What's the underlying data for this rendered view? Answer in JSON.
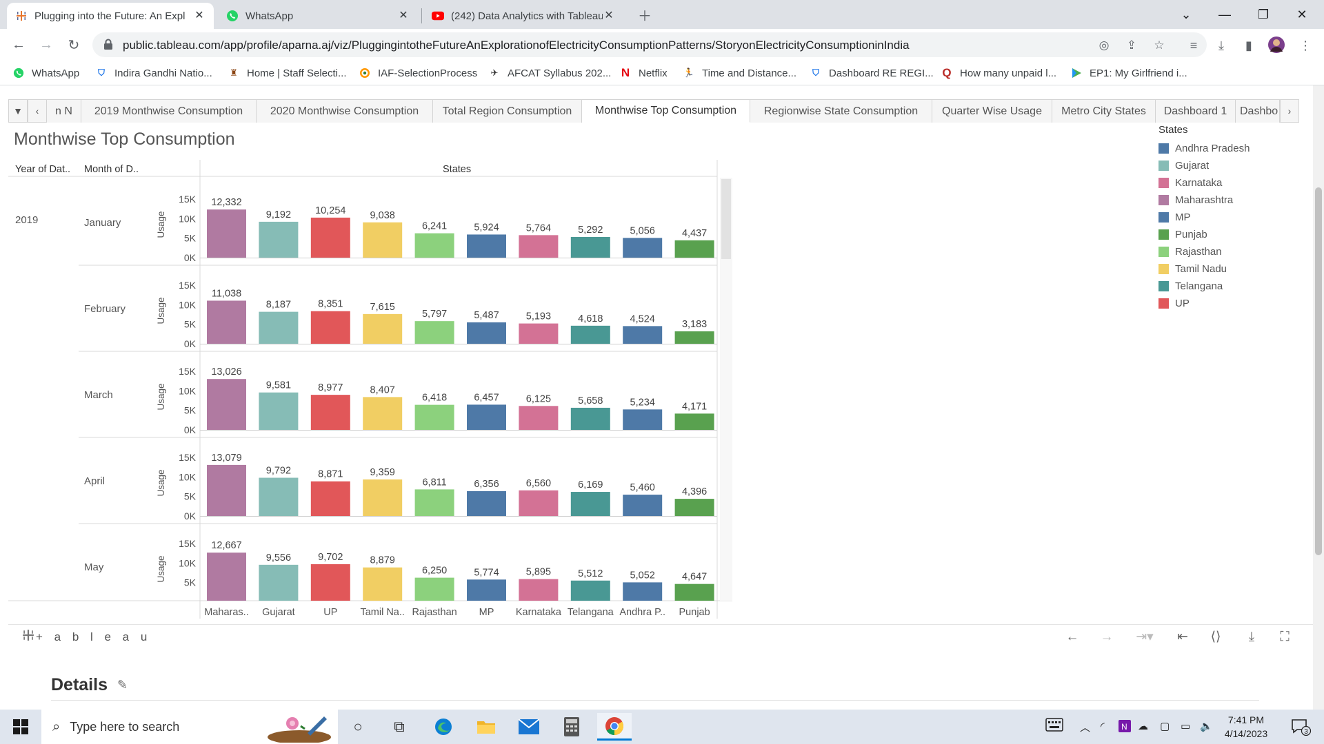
{
  "browser": {
    "tabs": [
      {
        "title": "Plugging into the Future: An Expl",
        "icon": "tableau-icon",
        "active": true
      },
      {
        "title": "WhatsApp",
        "icon": "whatsapp-icon",
        "active": false
      },
      {
        "title": "(242) Data Analytics with Tableau",
        "icon": "youtube-icon",
        "active": false
      }
    ],
    "url": "public.tableau.com/app/profile/aparna.aj/viz/PluggingintotheFutureAnExplorationofElectricityConsumptionPatterns/StoryonElectricityConsumptioninIndia",
    "bookmarks": [
      {
        "label": "WhatsApp",
        "icon": "whatsapp-icon",
        "color": "#25d366"
      },
      {
        "label": "Indira Gandhi Natio...",
        "icon": "shield-icon",
        "color": "#1a73e8"
      },
      {
        "label": "Home | Staff Selecti...",
        "icon": "emblem-icon",
        "color": "#8b4513"
      },
      {
        "label": "IAF-SelectionProcess",
        "icon": "roundel-icon",
        "color": "#ff9800"
      },
      {
        "label": "AFCAT Syllabus 202...",
        "icon": "plane-icon",
        "color": "#333333"
      },
      {
        "label": "Netflix",
        "icon": "netflix-icon",
        "color": "#e50914"
      },
      {
        "label": "Time and Distance...",
        "icon": "runner-icon",
        "color": "#2e7d32"
      },
      {
        "label": "Dashboard RE REGI...",
        "icon": "shield-icon",
        "color": "#1a73e8"
      },
      {
        "label": "How many unpaid l...",
        "icon": "quora-icon",
        "color": "#b92b27"
      },
      {
        "label": "EP1: My Girlfriend i...",
        "icon": "play-icon",
        "color": "#4caf50"
      }
    ]
  },
  "story": {
    "tabs": [
      "n N",
      "2019 Monthwise Consumption",
      "2020 Monthwise Consumption",
      "Total Region Consumption",
      "Monthwise Top Consumption",
      "Regionwise State Consumption",
      "Quarter Wise Usage",
      "Metro City States",
      "Dashboard 1",
      "Dashbo"
    ],
    "active_tab": "Monthwise Top Consumption"
  },
  "sheet": {
    "title": "Monthwise Top Consumption",
    "col_header_year": "Year of Dat..",
    "col_header_month": "Month of D..",
    "col_header_states": "States"
  },
  "chart_data": {
    "type": "bar",
    "title": "Monthwise Top Consumption",
    "ylabel": "Usage",
    "xlabel": "",
    "ylim": [
      0,
      15000
    ],
    "yticks": [
      "15K",
      "10K",
      "5K",
      "0K"
    ],
    "year": "2019",
    "categories": [
      "Maharas..",
      "Gujarat",
      "UP",
      "Tamil Na..",
      "Rajasthan",
      "MP",
      "Karnataka",
      "Telangana",
      "Andhra P..",
      "Punjab"
    ],
    "category_colors": [
      "#b07aa1",
      "#86bcb6",
      "#e15759",
      "#f1ce63",
      "#8cd17d",
      "#4e79a7",
      "#d37295",
      "#499894",
      "#4e79a7",
      "#59a14f"
    ],
    "series": [
      {
        "name": "January",
        "values": [
          12332,
          9192,
          10254,
          9038,
          6241,
          5924,
          5764,
          5292,
          5056,
          4437
        ]
      },
      {
        "name": "February",
        "values": [
          11038,
          8187,
          8351,
          7615,
          5797,
          5487,
          5193,
          4618,
          4524,
          3183
        ]
      },
      {
        "name": "March",
        "values": [
          13026,
          9581,
          8977,
          8407,
          6418,
          6457,
          6125,
          5658,
          5234,
          4171
        ]
      },
      {
        "name": "April",
        "values": [
          13079,
          9792,
          8871,
          9359,
          6811,
          6356,
          6560,
          6169,
          5460,
          4396
        ]
      },
      {
        "name": "May",
        "values": [
          12667,
          9556,
          9702,
          8879,
          6250,
          5774,
          5895,
          5512,
          5052,
          4647
        ]
      }
    ],
    "value_labels": [
      [
        "12,332",
        "9,192",
        "10,254",
        "9,038",
        "6,241",
        "5,924",
        "5,764",
        "5,292",
        "5,056",
        "4,437"
      ],
      [
        "11,038",
        "8,187",
        "8,351",
        "7,615",
        "5,797",
        "5,487",
        "5,193",
        "4,618",
        "4,524",
        "3,183"
      ],
      [
        "13,026",
        "9,581",
        "8,977",
        "8,407",
        "6,418",
        "6,457",
        "6,125",
        "5,658",
        "5,234",
        "4,171"
      ],
      [
        "13,079",
        "9,792",
        "8,871",
        "9,359",
        "6,811",
        "6,356",
        "6,560",
        "6,169",
        "5,460",
        "4,396"
      ],
      [
        "12,667",
        "9,556",
        "9,702",
        "8,879",
        "6,250",
        "5,774",
        "5,895",
        "5,512",
        "5,052",
        "4,647"
      ]
    ],
    "legend": {
      "title": "States",
      "position": "right",
      "items": [
        {
          "label": "Andhra Pradesh",
          "color": "#4e79a7"
        },
        {
          "label": "Gujarat",
          "color": "#86bcb6"
        },
        {
          "label": "Karnataka",
          "color": "#d37295"
        },
        {
          "label": "Maharashtra",
          "color": "#b07aa1"
        },
        {
          "label": "MP",
          "color": "#4e79a7"
        },
        {
          "label": "Punjab",
          "color": "#59a14f"
        },
        {
          "label": "Rajasthan",
          "color": "#8cd17d"
        },
        {
          "label": "Tamil Nadu",
          "color": "#f1ce63"
        },
        {
          "label": "Telangana",
          "color": "#499894"
        },
        {
          "label": "UP",
          "color": "#e15759"
        }
      ]
    },
    "grid": false
  },
  "tableau_footer": {
    "logo": "+ a b l e a u"
  },
  "details": {
    "label": "Details"
  },
  "taskbar": {
    "search_placeholder": "Type here to search",
    "time": "7:41 PM",
    "date": "4/14/2023",
    "notification_count": "3"
  }
}
